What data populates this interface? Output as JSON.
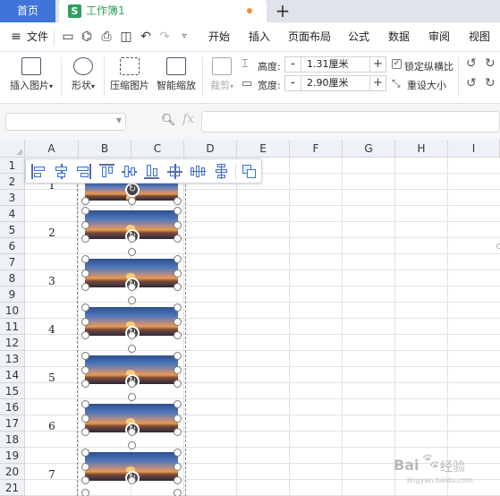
{
  "tabs": {
    "home": "首页",
    "workbook": "工作簿1",
    "workbook_icon": "S",
    "new_tab": "+"
  },
  "menu": {
    "file": "文件",
    "items": [
      "开始",
      "插入",
      "页面布局",
      "公式",
      "数据",
      "审阅",
      "视图"
    ]
  },
  "ribbon": {
    "insert_picture": "插入图片",
    "shape": "形状",
    "compress_picture": "压缩图片",
    "smart_zoom": "智能缩放",
    "crop": "裁剪",
    "height_label": "高度:",
    "height_value": "1.31厘米",
    "width_label": "宽度:",
    "width_value": "2.90厘米",
    "lock_ratio": "锁定纵横比",
    "reset_size": "重设大小",
    "plus": "+",
    "minus": "-"
  },
  "formula_bar": {
    "fx": "fx",
    "name_box_value": "",
    "formula_value": ""
  },
  "columns": [
    "A",
    "B",
    "C",
    "D",
    "E",
    "F",
    "G",
    "H",
    "I"
  ],
  "rows": [
    "1",
    "2",
    "3",
    "4",
    "5",
    "6",
    "7",
    "8",
    "9",
    "10",
    "11",
    "12",
    "13",
    "14",
    "15",
    "16",
    "17",
    "18",
    "19",
    "20",
    "21"
  ],
  "cell_numbers": [
    "1",
    "2",
    "3",
    "4",
    "5",
    "6",
    "7"
  ],
  "watermark": {
    "brand": "Bai",
    "brand2": "经验",
    "url": "jingyan.baidu.com"
  },
  "icons": {
    "rotate": "rotate-icon"
  },
  "colors": {
    "home_tab": "#3f74d9",
    "sheet_green": "#2fa05c",
    "modified_dot": "#f08a3c",
    "accent_blue": "#3c72d6"
  }
}
